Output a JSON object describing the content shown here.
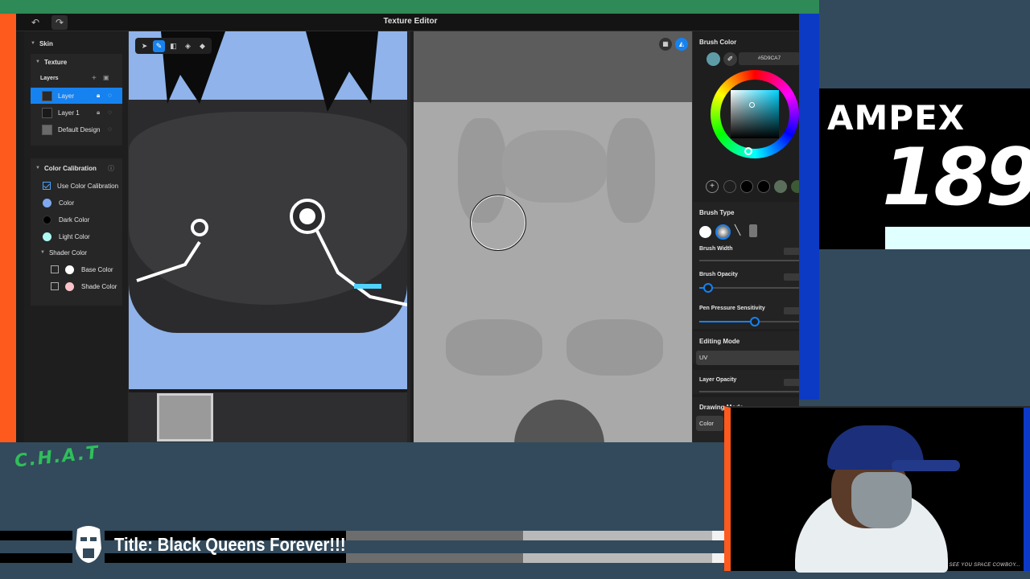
{
  "window": {
    "title": "Texture Editor"
  },
  "toolbar": {
    "undo_glyph": "↶",
    "redo_glyph": "↷"
  },
  "layers_panel": {
    "skin_label": "Skin",
    "texture_label": "Texture",
    "layers_header": "Layers",
    "layers": [
      {
        "name": "Layer",
        "selected": true
      },
      {
        "name": "Layer 1",
        "selected": false
      },
      {
        "name": "Default Design",
        "selected": false
      }
    ],
    "color_calibration": {
      "label": "Color Calibration",
      "use_label": "Use Color Calibration",
      "use_checked": true,
      "color_label": "Color",
      "color": "#7fa9ee",
      "dark_label": "Dark Color",
      "dark": "#000000",
      "light_label": "Light Color",
      "light": "#aff8f3"
    },
    "shader_color": {
      "label": "Shader Color",
      "base_label": "Base Color",
      "base": "#ffffff",
      "shade_label": "Shade Color",
      "shade": "#f9c3c9"
    }
  },
  "right_panel": {
    "brush_color_label": "Brush Color",
    "brush_color_hex": "#5D9CA7",
    "brush_color": "#5d9ca7",
    "palette": [
      "#000000",
      "#000000",
      "#000000",
      "#5b6e5b",
      "#3d5a36",
      "#5aa52a"
    ],
    "brush_type_label": "Brush Type",
    "brush_width_label": "Brush Width",
    "brush_opacity_label": "Brush Opacity",
    "brush_opacity_value": 0.09,
    "pen_pressure_label": "Pen Pressure Sensitivity",
    "pen_pressure_value": 0.55,
    "editing_mode_label": "Editing Mode",
    "editing_mode_value": "UV",
    "layer_opacity_label": "Layer Opacity",
    "drawing_mode_label": "Drawing Mode",
    "drawing_mode_value": "Color"
  },
  "overlay": {
    "brand_name": "AMPEX",
    "brand_number": "189",
    "chat_logo": "C.H.A.T",
    "stream_title": "Title: Black Queens Forever!!!",
    "cam_caption": "SEE YOU SPACE COWBOY..."
  },
  "colors": {
    "accent": "#1682f0",
    "overlay_green": "#2e8a56",
    "overlay_orange": "#ff5a1e",
    "overlay_blue": "#0c3ac4"
  }
}
